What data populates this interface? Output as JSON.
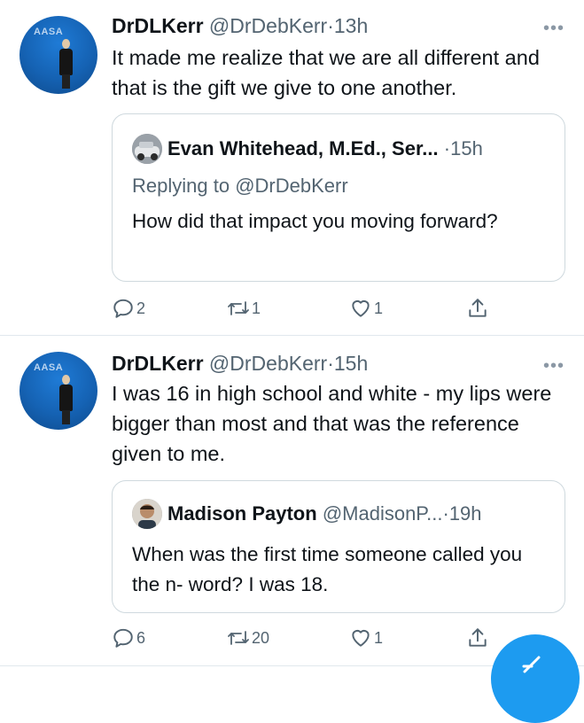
{
  "tweets": [
    {
      "name": "DrDLKerr",
      "handle": "@DrDebKerr",
      "dot": "·",
      "time": "13h",
      "avatar_logo": "AASA",
      "more": "•••",
      "text": "It made me realize that we are all different and that is the gift we give to one another.",
      "quote": {
        "name": "Evan Whitehead, M.Ed., Ser...",
        "dot": "·",
        "time": "15h",
        "replying_prefix": "Replying to",
        "replying_handle": "@DrDebKerr",
        "text": "How did that impact you moving forward?"
      },
      "actions": {
        "replies": "2",
        "retweets": "1",
        "likes": "1"
      }
    },
    {
      "name": "DrDLKerr",
      "handle": "@DrDebKerr",
      "dot": "·",
      "time": "15h",
      "avatar_logo": "AASA",
      "more": "•••",
      "text": "I was 16 in high school and white - my lips were bigger than most and that was the reference given to me.",
      "quote": {
        "name": "Madison Payton",
        "handle": "@MadisonP...",
        "dot": "·",
        "time": "19h",
        "text": "When was the first time someone called you the n- word? I was 18."
      },
      "actions": {
        "replies": "6",
        "retweets": "20",
        "likes": "1"
      }
    }
  ],
  "icons": {
    "reply": "reply-icon",
    "retweet": "retweet-icon",
    "like": "heart-icon",
    "share": "share-icon",
    "compose": "compose-icon"
  },
  "colors": {
    "accent": "#1d9bf0",
    "secondary_text": "#536471",
    "border": "#cfd9de"
  }
}
